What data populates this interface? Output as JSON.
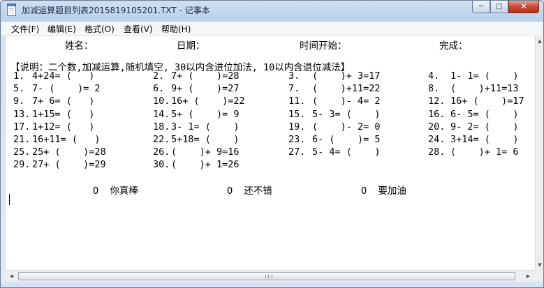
{
  "window": {
    "title": "加减运算题目列表2015819105201.TXT - 记事本"
  },
  "caption": {
    "minimize": "─",
    "maximize": "□",
    "close": "✕"
  },
  "menu": [
    {
      "id": "file",
      "label": "文件(F)"
    },
    {
      "id": "edit",
      "label": "编辑(E)"
    },
    {
      "id": "format",
      "label": "格式(O)"
    },
    {
      "id": "view",
      "label": "查看(V)"
    },
    {
      "id": "help",
      "label": "帮助(H)"
    }
  ],
  "header": {
    "name": "姓名：",
    "date": "日期：",
    "start_time": "时间开始：",
    "done": "完成："
  },
  "instruction": "【说明：二个数,加减运算,随机填空, 30以内含进位加法, 10以内含退位减法】",
  "problems": [
    {
      "n": "1.",
      "expr": "4+24= (   )"
    },
    {
      "n": "2.",
      "expr": "7+ (    )=28"
    },
    {
      "n": "3.",
      "expr": "(    )+ 3=17"
    },
    {
      "n": "4.",
      "expr": "1- 1= (    )"
    },
    {
      "n": "5.",
      "expr": "7- (    )= 2"
    },
    {
      "n": "6.",
      "expr": "9+ (    )=27"
    },
    {
      "n": "7.",
      "expr": "(    )+11=22"
    },
    {
      "n": "8.",
      "expr": "(    )+11=13"
    },
    {
      "n": "9.",
      "expr": "7+ 6= (   )"
    },
    {
      "n": "10.",
      "expr": "16+ (    )=22"
    },
    {
      "n": "11.",
      "expr": "(    )- 4= 2"
    },
    {
      "n": "12.",
      "expr": "16+ (    )=17"
    },
    {
      "n": "13.",
      "expr": "1+15= (   )"
    },
    {
      "n": "14.",
      "expr": "5+ (    )= 9"
    },
    {
      "n": "15.",
      "expr": "5- 3= (    )"
    },
    {
      "n": "16.",
      "expr": "6- 5= (    )"
    },
    {
      "n": "17.",
      "expr": "1+12= (   )"
    },
    {
      "n": "18.",
      "expr": "3- 1= (    )"
    },
    {
      "n": "19.",
      "expr": "(    )- 2= 0"
    },
    {
      "n": "20.",
      "expr": "9- 2= (    )"
    },
    {
      "n": "21.",
      "expr": "16+11= (   )"
    },
    {
      "n": "22.",
      "expr": "5+18= (    )"
    },
    {
      "n": "23.",
      "expr": "6- (    )= 5"
    },
    {
      "n": "24.",
      "expr": "3+14= (    )"
    },
    {
      "n": "25.",
      "expr": "25+ (    )=28"
    },
    {
      "n": "26.",
      "expr": "(    )+ 9=16"
    },
    {
      "n": "27.",
      "expr": "5- 4= (    )"
    },
    {
      "n": "28.",
      "expr": "(    )+ 1= 6"
    },
    {
      "n": "29.",
      "expr": "27+ (    )=29"
    },
    {
      "n": "30.",
      "expr": "(    )+ 1=26"
    }
  ],
  "ratings": [
    "O  你真棒",
    "O  还不错",
    "O  要加油"
  ],
  "scrollbar": {
    "up": "▲",
    "down": "▼",
    "left": "◀",
    "right": "▶"
  }
}
